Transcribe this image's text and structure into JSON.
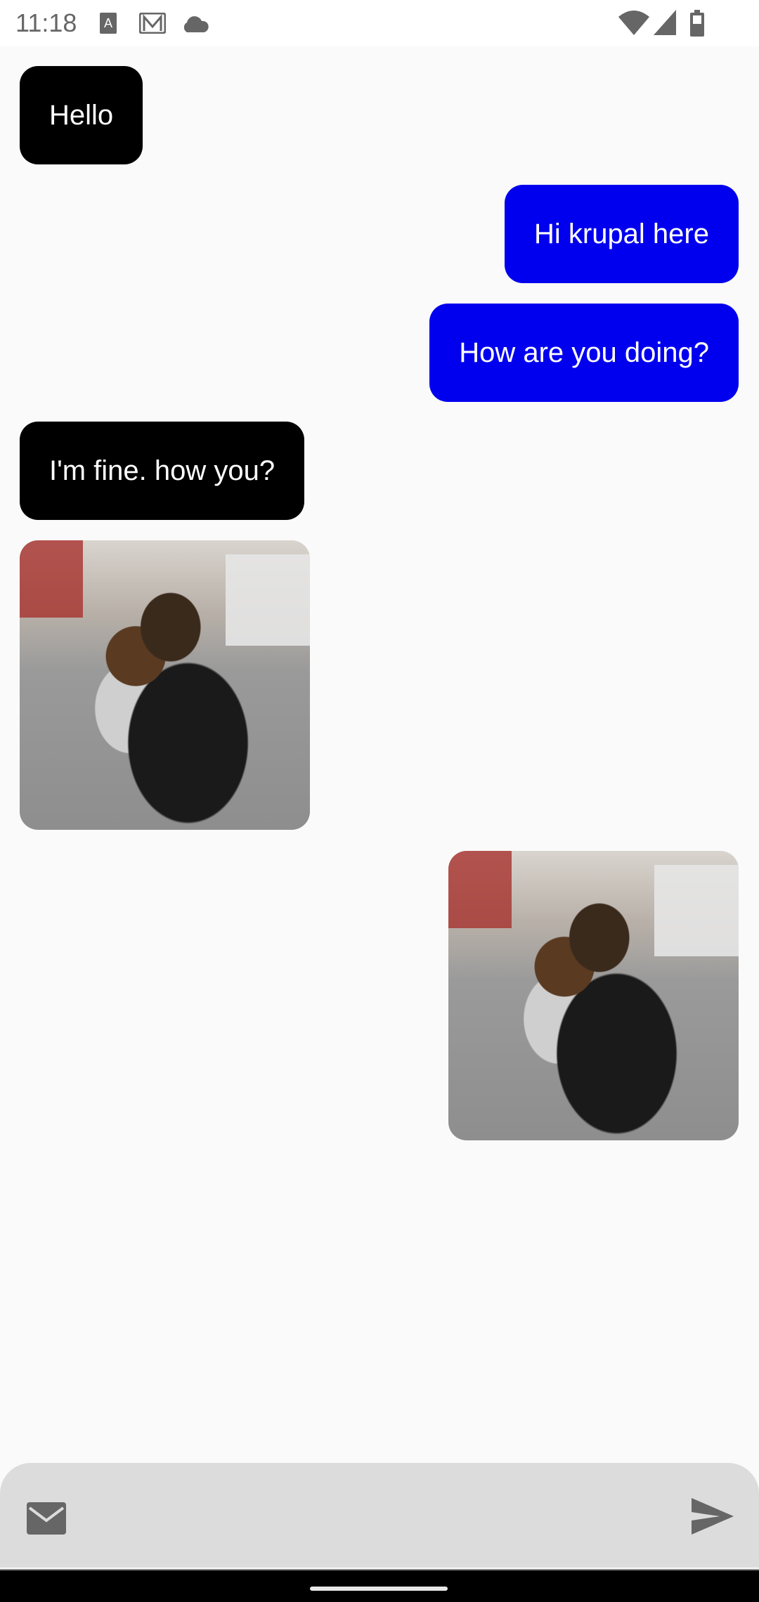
{
  "status_bar": {
    "time": "11:18"
  },
  "messages": [
    {
      "type": "text",
      "side": "received",
      "text": "Hello"
    },
    {
      "type": "text",
      "side": "sent",
      "text": "Hi krupal here"
    },
    {
      "type": "text",
      "side": "sent",
      "text": "How are you doing?"
    },
    {
      "type": "text",
      "side": "received",
      "text": "I'm fine. how you?"
    },
    {
      "type": "image",
      "side": "received",
      "icon": "photo-mother-child"
    },
    {
      "type": "image",
      "side": "sent",
      "icon": "photo-mother-child"
    }
  ],
  "composer": {
    "placeholder": "",
    "value": "",
    "left_icon": "mail-icon",
    "send_icon": "send-icon"
  },
  "colors": {
    "sent": "#0000ee",
    "received": "#000000",
    "composer": "#dcdcdc"
  }
}
